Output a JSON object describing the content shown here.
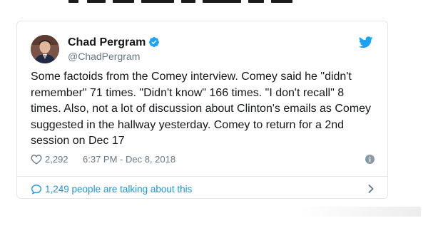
{
  "tweet": {
    "author_name": "Chad Pergram",
    "author_handle": "@ChadPergram",
    "text_lines": [
      "Some factoids from the Comey interview. Comey said he \"didn't",
      "remember\" 71 times. \"Didn't know\" 166 times. \"I don't recall\" 8",
      "times. Also, not a lot of discussion about Clinton's emails as Comey",
      "suggested in the hallway yesterday. Comey to return for a 2nd",
      "session on Dec 17"
    ],
    "like_count": "2,292",
    "timestamp": "6:37 PM - Dec 8, 2018",
    "talking_text": "1,249 people are talking about this"
  },
  "colors": {
    "accent": "#1da1f2",
    "link": "#1b95e0",
    "text": "#14171a",
    "muted": "#657786",
    "border": "#e1e8ed"
  },
  "icons": {
    "verified": "verified-badge-icon",
    "bird": "twitter-bird-icon",
    "heart": "heart-icon",
    "info": "info-icon",
    "reply": "speech-bubble-icon",
    "chevron": "chevron-right-icon"
  }
}
